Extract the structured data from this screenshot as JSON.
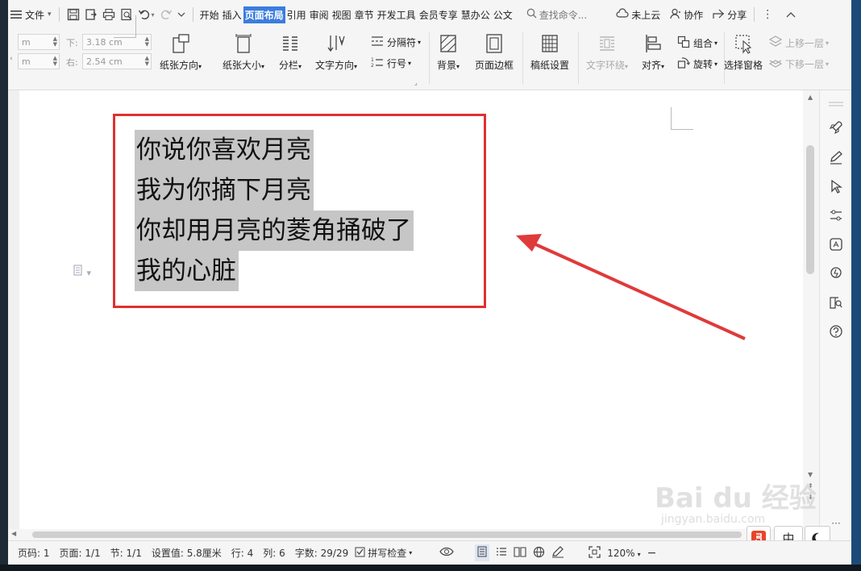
{
  "menubar": {
    "file_label": "文件",
    "tabs": [
      "开始",
      "插入",
      "页面布局",
      "引用",
      "审阅",
      "视图",
      "章节",
      "开发工具",
      "会员专享",
      "慧办公",
      "公文"
    ],
    "active_tab": "页面布局",
    "search_placeholder": "查找命令...",
    "cloud_label": "未上云",
    "collab_label": "协作",
    "share_label": "分享"
  },
  "ribbon": {
    "margin_left_label": "m",
    "margin_left2_label": "m",
    "margin_bottom_label": "下:",
    "margin_bottom_value": "3.18 cm",
    "margin_right_label": "右:",
    "margin_right_value": "2.54 cm",
    "orientation": "纸张方向",
    "size": "纸张大小",
    "columns": "分栏",
    "text_direction": "文字方向",
    "separator": "分隔符",
    "line_numbers": "行号",
    "background": "背景",
    "page_border": "页面边框",
    "manuscript": "稿纸设置",
    "wrap": "文字环绕",
    "align": "对齐",
    "group": "组合",
    "rotate": "旋转",
    "selection_pane": "选择窗格",
    "bring_forward": "上移一层",
    "send_backward": "下移一层"
  },
  "document": {
    "lines": [
      "你说你喜欢月亮",
      "我为你摘下月亮",
      "你却用月亮的菱角捅破了",
      "我的心脏"
    ]
  },
  "status": {
    "page_no": "页码: 1",
    "pages": "页面: 1/1",
    "section": "节: 1/1",
    "setting": "设置值: 5.8厘米",
    "row": "行: 4",
    "col": "列: 6",
    "words": "字数: 29/29",
    "spell": "拼写检查",
    "zoom": "120%"
  },
  "watermark": {
    "brand": "Bai du 经验",
    "url": "jingyan.baidu.com"
  },
  "ime": {
    "lang": "中"
  },
  "colors": {
    "accent": "#3b7ddd",
    "annotation": "#e03030",
    "highlight": "#c6c6c6"
  }
}
